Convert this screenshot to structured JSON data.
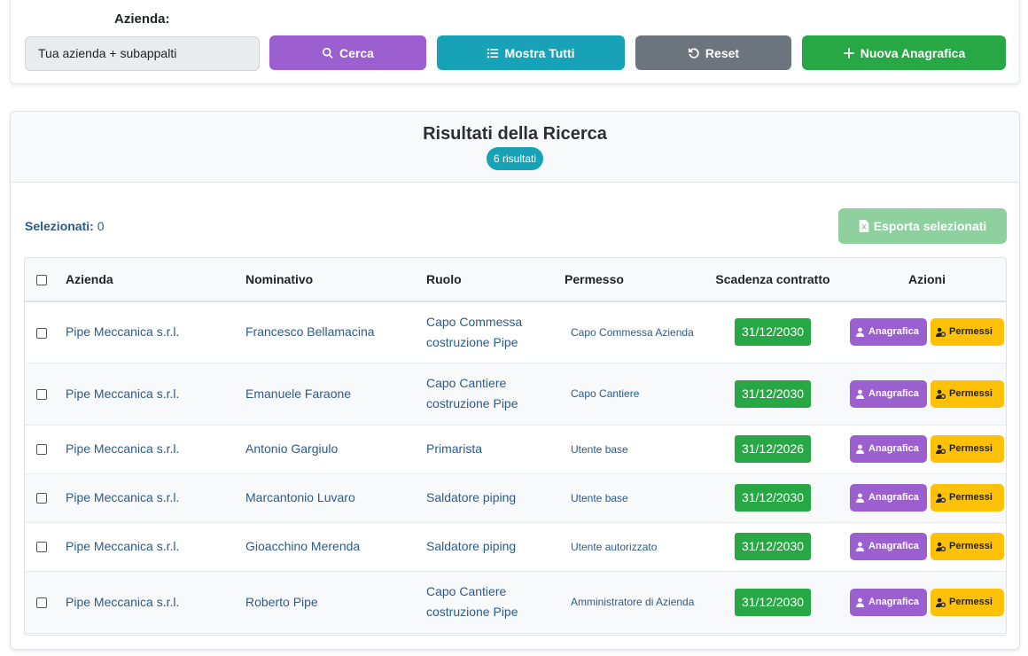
{
  "filter": {
    "label": "Azienda:",
    "value": "Tua azienda + subappalti",
    "buttons": {
      "search": "Cerca",
      "show_all": "Mostra Tutti",
      "reset": "Reset",
      "new": "Nuova Anagrafica"
    }
  },
  "results": {
    "title": "Risultati della Ricerca",
    "count_badge": "6 risultati",
    "selected_label": "Selezionati:",
    "selected_count": "0",
    "export_label": "Esporta selezionati",
    "columns": [
      "Azienda",
      "Nominativo",
      "Ruolo",
      "Permesso",
      "Scadenza contratto",
      "Azioni"
    ],
    "action_labels": {
      "profile": "Anagrafica",
      "permissions": "Permessi"
    },
    "rows": [
      {
        "azienda": "Pipe Meccanica s.r.l.",
        "nominativo": "Francesco Bellamacina",
        "ruolo": "Capo Commessa costruzione Pipe",
        "permesso": "Capo Commessa Azienda",
        "scadenza": "31/12/2030"
      },
      {
        "azienda": "Pipe Meccanica s.r.l.",
        "nominativo": "Emanuele Faraone",
        "ruolo": "Capo Cantiere costruzione Pipe",
        "permesso": "Capo Cantiere",
        "scadenza": "31/12/2030"
      },
      {
        "azienda": "Pipe Meccanica s.r.l.",
        "nominativo": "Antonio Gargiulo",
        "ruolo": "Primarista",
        "permesso": "Utente base",
        "scadenza": "31/12/2026"
      },
      {
        "azienda": "Pipe Meccanica s.r.l.",
        "nominativo": "Marcantonio Luvaro",
        "ruolo": "Saldatore piping",
        "permesso": "Utente base",
        "scadenza": "31/12/2030"
      },
      {
        "azienda": "Pipe Meccanica s.r.l.",
        "nominativo": "Gioacchino Merenda",
        "ruolo": "Saldatore piping",
        "permesso": "Utente autorizzato",
        "scadenza": "31/12/2030"
      },
      {
        "azienda": "Pipe Meccanica s.r.l.",
        "nominativo": "Roberto Pipe",
        "ruolo": "Capo Cantiere costruzione Pipe",
        "permesso": "Amministratore di Azienda",
        "scadenza": "31/12/2030"
      }
    ]
  },
  "colors": {
    "search": "#9b5fd0",
    "show_all": "#17a2b8",
    "reset": "#6c757d",
    "new": "#28a745",
    "export": "#8fd19e",
    "permissions": "#ffc107"
  },
  "icons": {
    "search": "search-icon",
    "show_all": "list-icon",
    "reset": "undo-icon",
    "new": "plus-icon",
    "export": "file-excel-icon",
    "profile": "user-icon",
    "permissions": "user-cog-icon"
  }
}
